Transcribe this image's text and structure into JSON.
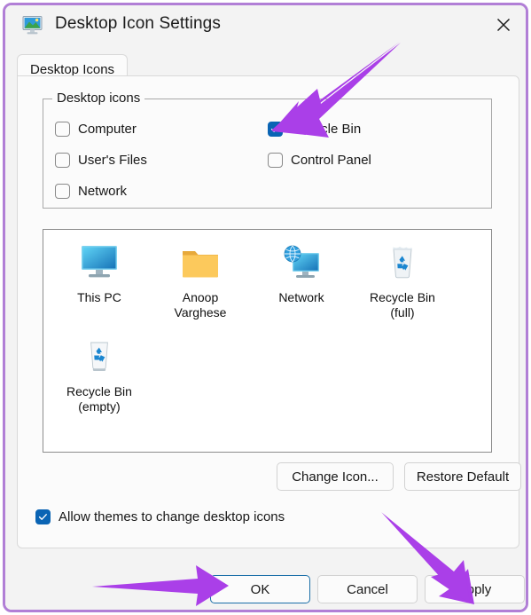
{
  "window": {
    "title": "Desktop Icon Settings",
    "title_icon": "desktop-monitor-icon",
    "close_label": "✕",
    "border_color": "#b17fd6"
  },
  "tabs": [
    {
      "label": "Desktop Icons",
      "selected": true
    }
  ],
  "group": {
    "label": "Desktop icons",
    "checkboxes": [
      {
        "label": "Computer",
        "checked": false,
        "column": "left",
        "row": 0
      },
      {
        "label": "User's Files",
        "checked": false,
        "column": "left",
        "row": 1
      },
      {
        "label": "Network",
        "checked": false,
        "column": "left",
        "row": 2
      },
      {
        "label": "Recycle Bin",
        "checked": true,
        "column": "right",
        "row": 0
      },
      {
        "label": "Control Panel",
        "checked": false,
        "column": "right",
        "row": 1
      }
    ]
  },
  "preview": {
    "items": [
      {
        "caption_line1": "This PC",
        "caption_line2": "",
        "icon": "monitor-icon"
      },
      {
        "caption_line1": "Anoop",
        "caption_line2": "Varghese",
        "icon": "folder-icon"
      },
      {
        "caption_line1": "Network",
        "caption_line2": "",
        "icon": "network-globe-monitor-icon"
      },
      {
        "caption_line1": "Recycle Bin",
        "caption_line2": "(full)",
        "icon": "recycle-bin-full-icon"
      },
      {
        "caption_line1": "Recycle Bin",
        "caption_line2": "(empty)",
        "icon": "recycle-bin-empty-icon"
      }
    ]
  },
  "icon_buttons": {
    "change_icon": "Change Icon...",
    "restore_default": "Restore Default"
  },
  "allow_themes": {
    "label": "Allow themes to change desktop icons",
    "checked": true
  },
  "footer": {
    "ok": "OK",
    "cancel": "Cancel",
    "apply": "Apply"
  },
  "annotations": {
    "color": "#aa3fe8",
    "arrows": [
      {
        "name": "arrow-to-recycle-bin-checkbox",
        "points_to": "Recycle Bin"
      },
      {
        "name": "arrow-to-ok-button",
        "points_to": "OK"
      },
      {
        "name": "arrow-to-apply-button",
        "points_to": "Apply"
      }
    ]
  },
  "colors": {
    "checkbox_checked": "#0a64b4",
    "window_background": "#f3f3f3",
    "panel_background": "#fbfbfb",
    "accent_focus": "#1b6fa8"
  }
}
